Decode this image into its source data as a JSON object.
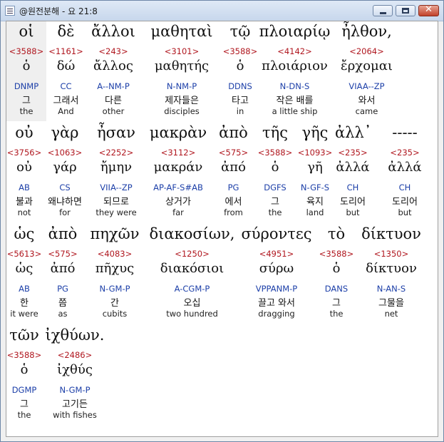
{
  "window": {
    "title": "@원전분해 - 요 21:8"
  },
  "tokens": [
    {
      "greek": "οἱ",
      "strong": "<3588>",
      "lemma": "ὁ",
      "parse": "DNMP",
      "korean": "그",
      "english": "the",
      "selected": true
    },
    {
      "greek": "δὲ",
      "strong": "<1161>",
      "lemma": "δώ",
      "parse": "CC",
      "korean": "그래서",
      "english": "And"
    },
    {
      "greek": "ἄλλοι",
      "strong": "<243>",
      "lemma": "ἄλλος",
      "parse": "A--NM-P",
      "korean": "다른",
      "english": "other"
    },
    {
      "greek": "μαθηταὶ",
      "strong": "<3101>",
      "lemma": "μαθητής",
      "parse": "N-NM-P",
      "korean": "제자들은",
      "english": "disciples"
    },
    {
      "greek": "τῷ",
      "strong": "<3588>",
      "lemma": "ὁ",
      "parse": "DDNS",
      "korean": "타고",
      "english": "in"
    },
    {
      "greek": "πλοιαρίῳ",
      "strong": "<4142>",
      "lemma": "πλοιάριον",
      "parse": "N-DN-S",
      "korean": "작은 배를",
      "english": "a little ship"
    },
    {
      "greek": "ἦλθον,",
      "strong": "<2064>",
      "lemma": "ἔρχομαι",
      "parse": "VIAA--ZP",
      "korean": "와서",
      "english": "came"
    },
    {
      "greek": "οὐ",
      "strong": "<3756>",
      "lemma": "οὐ",
      "parse": "AB",
      "korean": "불과",
      "english": "not"
    },
    {
      "greek": "γὰρ",
      "strong": "<1063>",
      "lemma": "γάρ",
      "parse": "CS",
      "korean": "왜냐하면",
      "english": "for"
    },
    {
      "greek": "ἦσαν",
      "strong": "<2252>",
      "lemma": "ἤμην",
      "parse": "VIIA--ZP",
      "korean": "되므로",
      "english": "they were"
    },
    {
      "greek": "μακρὰν",
      "strong": "<3112>",
      "lemma": "μακράν",
      "parse": "AP-AF-S#AB",
      "korean": "상거가",
      "english": "far"
    },
    {
      "greek": "ἀπὸ",
      "strong": "<575>",
      "lemma": "ἀπό",
      "parse": "PG",
      "korean": "에서",
      "english": "from"
    },
    {
      "greek": "τῆς",
      "strong": "<3588>",
      "lemma": "ὁ",
      "parse": "DGFS",
      "korean": "그",
      "english": "the"
    },
    {
      "greek": "γῆς",
      "strong": "<1093>",
      "lemma": "γῆ",
      "parse": "N-GF-S",
      "korean": "육지",
      "english": "land"
    },
    {
      "greek": "ἀλλ᾽",
      "strong": "<235>",
      "lemma": "ἀλλά",
      "parse": "CH",
      "korean": "도리어",
      "english": "but"
    },
    {
      "greek": "-----",
      "strong": "<235>",
      "lemma": "ἀλλά",
      "parse": "CH",
      "korean": "도리어",
      "english": "but"
    },
    {
      "greek": "ὡς",
      "strong": "<5613>",
      "lemma": "ὡς",
      "parse": "AB",
      "korean": "한",
      "english": "it were"
    },
    {
      "greek": "ἀπὸ",
      "strong": "<575>",
      "lemma": "ἀπό",
      "parse": "PG",
      "korean": "쯤",
      "english": "as"
    },
    {
      "greek": "πηχῶν",
      "strong": "<4083>",
      "lemma": "πῆχυς",
      "parse": "N-GM-P",
      "korean": "간",
      "english": "cubits"
    },
    {
      "greek": "διακοσίων,",
      "strong": "<1250>",
      "lemma": "διακόσιοι",
      "parse": "A-CGM-P",
      "korean": "오십",
      "english": "two hundred"
    },
    {
      "greek": "σύροντες",
      "strong": "<4951>",
      "lemma": "σύρω",
      "parse": "VPPANM-P",
      "korean": "끌고 와서",
      "english": "dragging"
    },
    {
      "greek": "τὸ",
      "strong": "<3588>",
      "lemma": "ὁ",
      "parse": "DANS",
      "korean": "그",
      "english": "the"
    },
    {
      "greek": "δίκτυον",
      "strong": "<1350>",
      "lemma": "δίκτυον",
      "parse": "N-AN-S",
      "korean": "그물을",
      "english": "net"
    },
    {
      "greek": "τῶν",
      "strong": "<3588>",
      "lemma": "ὁ",
      "parse": "DGMP",
      "korean": "그",
      "english": "the"
    },
    {
      "greek": "ἰχθύων.",
      "strong": "<2486>",
      "lemma": "ἰχθύς",
      "parse": "N-GM-P",
      "korean": "고기든",
      "english": "with fishes"
    }
  ]
}
